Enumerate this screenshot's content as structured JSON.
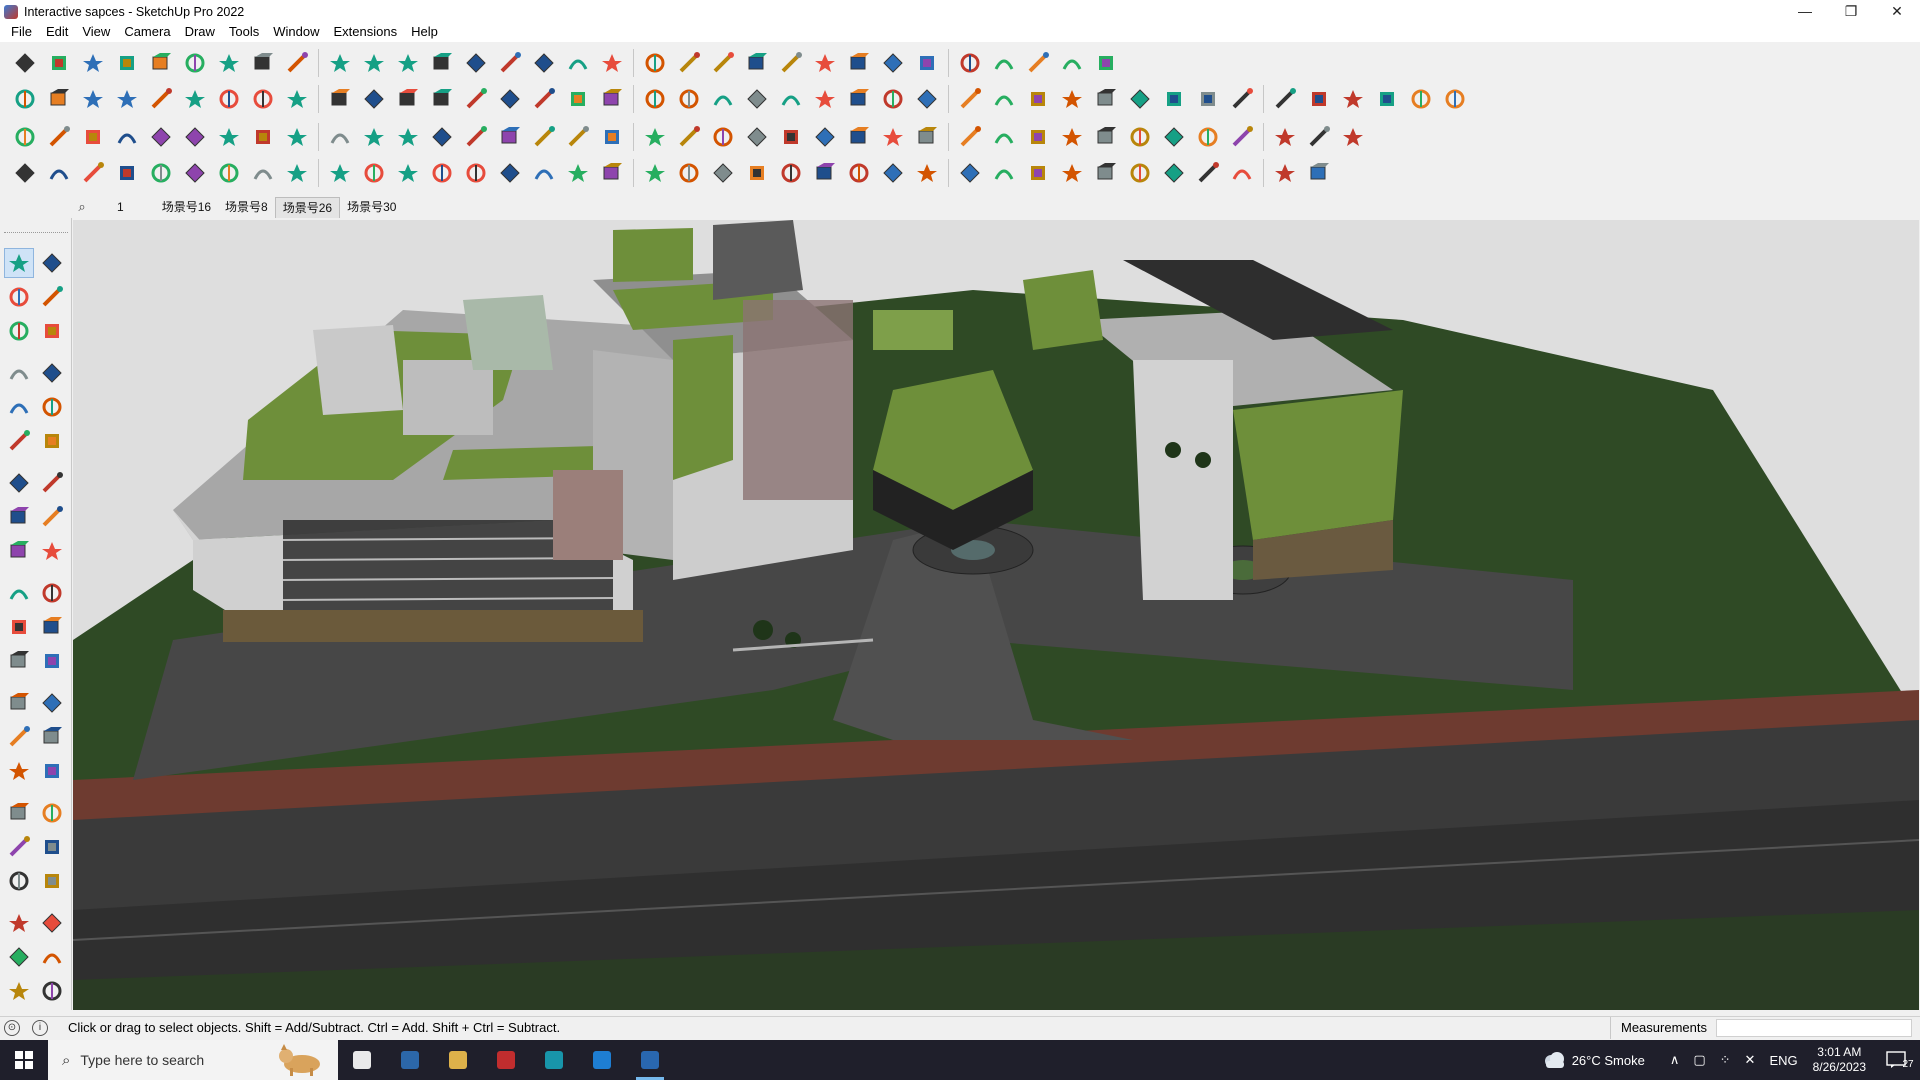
{
  "window": {
    "title": "Interactive sapces - SketchUp Pro 2022",
    "minimize": "—",
    "restore": "❐",
    "close": "✕"
  },
  "menu": [
    "File",
    "Edit",
    "View",
    "Camera",
    "Draw",
    "Tools",
    "Window",
    "Extensions",
    "Help"
  ],
  "toolbar": {
    "row1": [
      "zoom-icon",
      "select-icon",
      "eraser-icon",
      "pencil-line-icon",
      "lasso-icon",
      "shape-icon",
      "push-pull-icon",
      "follow-me-icon",
      "move-icon",
      "rotate-icon",
      "scale-icon",
      "tape-icon",
      "text-icon",
      "paint-icon",
      "orbit-icon",
      "pan-icon",
      "zoom-window-icon",
      "zoom-extents-icon",
      "layers-icon",
      "section-icon",
      "styles-icon",
      "component-icon",
      "user-icon",
      "import-icon",
      "export-icon",
      "sort-up-icon",
      "sort-down-icon",
      "axis-icon",
      "mirror-icon",
      "undo-icon",
      "redo-icon",
      "help-icon"
    ],
    "row2": [
      "box-icon",
      "cylinder-icon",
      "sphere-icon",
      "stack-icon",
      "arrow-up-icon",
      "arrow-down-icon",
      "arrow-right-icon",
      "arrow-left-icon",
      "arrow-n-icon",
      "arrow-s-icon",
      "arrow-ne-icon",
      "curve-icon",
      "wall-icon",
      "window-icon",
      "door-icon",
      "roof-icon",
      "house-icon",
      "house2-icon",
      "house3-icon",
      "fence-icon",
      "formula-icon",
      "leaf-icon",
      "ruler-icon",
      "shape1-icon",
      "shape2-icon",
      "shape3-icon",
      "shape4-icon",
      "shape5-icon",
      "shape6-icon",
      "shape7-icon",
      "shape8-icon",
      "shape9-icon",
      "shape10-icon",
      "red-arrow-icon",
      "pink-tag-icon",
      "brick-icon",
      "grid-icon",
      "stair-icon",
      "roof2-icon",
      "cup-icon",
      "board-icon",
      "slab-icon"
    ],
    "row3": [
      "plane-blue-icon",
      "plane-blue2-icon",
      "plane-yellow-icon",
      "gem-icon",
      "texture-icon",
      "sketch-icon",
      "plane-red-icon",
      "red-box-icon",
      "stripes-icon",
      "flag-icon",
      "chair-icon",
      "link-icon",
      "corner-icon",
      "curve2-icon",
      "cross-red-icon",
      "cross-green-icon",
      "cross-blue-icon",
      "cone-icon",
      "tree-icon",
      "warning-icon",
      "hook-icon",
      "knot-icon",
      "spiral-icon",
      "crosshair-icon",
      "bucket-icon",
      "loop-icon",
      "green-glyph-icon",
      "glyph2-icon",
      "glyph3-icon",
      "glyph4-icon",
      "glyph5-icon",
      "glyph6-icon",
      "glyph7-icon",
      "glyph8-icon",
      "orange-grid-icon",
      "orange-grid2-icon",
      "scatter-icon",
      "arc-icon",
      "table-icon"
    ],
    "row4": [
      "path-icon",
      "path2-icon",
      "car-icon",
      "ring-icon",
      "spline-icon",
      "fillet-icon",
      "bend-icon",
      "ribbon-icon",
      "extrude-icon",
      "rafter-icon",
      "rafter2-icon",
      "line-icon",
      "line2-icon",
      "beam-icon",
      "arch-icon",
      "cone2-icon",
      "fence2-icon",
      "fence3-icon",
      "hand-icon",
      "leaf2-icon",
      "plant-icon",
      "stairs2-icon",
      "roofpitch-icon",
      "stairs3-icon",
      "stairs4-icon",
      "stairs5-icon",
      "house-dark-icon",
      "panel-icon",
      "panel2-icon",
      "panel3-icon",
      "panel4-icon",
      "panel5-icon",
      "panel6-icon",
      "panel7-icon",
      "panel8-icon",
      "panel9-icon",
      "panel10-icon",
      "panel11-icon"
    ]
  },
  "scenes": {
    "page_number": "1",
    "tabs": [
      {
        "label": "场景号16",
        "active": false
      },
      {
        "label": "场景号8",
        "active": false
      },
      {
        "label": "场景号26",
        "active": true
      },
      {
        "label": "场景号30",
        "active": false
      }
    ]
  },
  "left_tools": [
    "select-arrow-icon",
    "make-component-icon",
    "paint-bucket-icon",
    "eraser-icon",
    "tag-icon",
    "pencil-icon",
    "line-icon",
    "freehand-icon",
    "rectangle-icon",
    "rotated-rect-icon",
    "circle-icon",
    "polygon-icon",
    "arc-icon",
    "pie-icon",
    "two-point-arc-icon",
    "three-point-arc-icon",
    "move-icon",
    "push-pull-icon",
    "rotate-icon",
    "follow-me-icon",
    "scale-icon",
    "offset-icon",
    "tape-measure-icon",
    "dimension-icon",
    "protractor-icon",
    "text-icon",
    "axes-icon",
    "3d-text-icon",
    "orbit-icon",
    "pan-icon",
    "zoom-icon",
    "zoom-window-icon",
    "zoom-extents-icon",
    "previous-view-icon",
    "position-camera-icon",
    "look-around-icon",
    "walk-icon",
    "section-plane-icon",
    "layer-icon",
    "styles-icon",
    "sandbox-icon",
    "sandbox2-icon"
  ],
  "status": {
    "hint": "Click or drag to select objects. Shift = Add/Subtract. Ctrl = Add. Shift + Ctrl = Subtract.",
    "measurements_label": "Measurements",
    "measurements_value": ""
  },
  "taskbar": {
    "search_placeholder": "Type here to search",
    "weather": "26°C  Smoke",
    "language": "ENG",
    "time": "3:01 AM",
    "date": "8/26/2023",
    "notification_count": "27",
    "pinned": [
      "task-view-icon",
      "calculator-icon",
      "file-explorer-icon",
      "acrobat-icon",
      "app-3-icon",
      "edge-icon",
      "sketchup-icon"
    ]
  },
  "colors": {
    "roof_green": "#6b8e3a",
    "building_gray": "#bdbdbd",
    "road_dark": "#3d3d3d",
    "grass_dark": "#2e4a24",
    "sky": "#dcdcdc"
  }
}
